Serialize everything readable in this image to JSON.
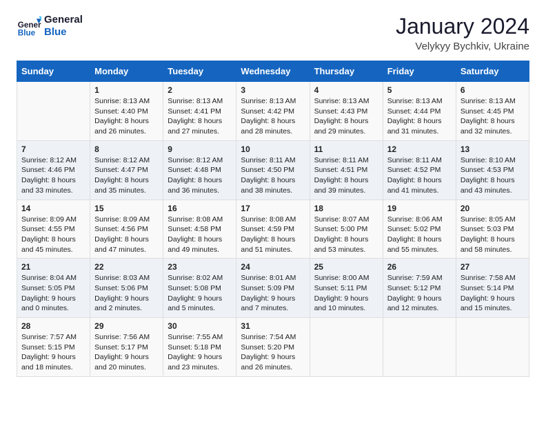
{
  "header": {
    "logo_line1": "General",
    "logo_line2": "Blue",
    "title": "January 2024",
    "subtitle": "Velykyy Bychkiv, Ukraine"
  },
  "columns": [
    "Sunday",
    "Monday",
    "Tuesday",
    "Wednesday",
    "Thursday",
    "Friday",
    "Saturday"
  ],
  "weeks": [
    [
      {
        "day": "",
        "text": ""
      },
      {
        "day": "1",
        "text": "Sunrise: 8:13 AM\nSunset: 4:40 PM\nDaylight: 8 hours\nand 26 minutes."
      },
      {
        "day": "2",
        "text": "Sunrise: 8:13 AM\nSunset: 4:41 PM\nDaylight: 8 hours\nand 27 minutes."
      },
      {
        "day": "3",
        "text": "Sunrise: 8:13 AM\nSunset: 4:42 PM\nDaylight: 8 hours\nand 28 minutes."
      },
      {
        "day": "4",
        "text": "Sunrise: 8:13 AM\nSunset: 4:43 PM\nDaylight: 8 hours\nand 29 minutes."
      },
      {
        "day": "5",
        "text": "Sunrise: 8:13 AM\nSunset: 4:44 PM\nDaylight: 8 hours\nand 31 minutes."
      },
      {
        "day": "6",
        "text": "Sunrise: 8:13 AM\nSunset: 4:45 PM\nDaylight: 8 hours\nand 32 minutes."
      }
    ],
    [
      {
        "day": "7",
        "text": "Sunrise: 8:12 AM\nSunset: 4:46 PM\nDaylight: 8 hours\nand 33 minutes."
      },
      {
        "day": "8",
        "text": "Sunrise: 8:12 AM\nSunset: 4:47 PM\nDaylight: 8 hours\nand 35 minutes."
      },
      {
        "day": "9",
        "text": "Sunrise: 8:12 AM\nSunset: 4:48 PM\nDaylight: 8 hours\nand 36 minutes."
      },
      {
        "day": "10",
        "text": "Sunrise: 8:11 AM\nSunset: 4:50 PM\nDaylight: 8 hours\nand 38 minutes."
      },
      {
        "day": "11",
        "text": "Sunrise: 8:11 AM\nSunset: 4:51 PM\nDaylight: 8 hours\nand 39 minutes."
      },
      {
        "day": "12",
        "text": "Sunrise: 8:11 AM\nSunset: 4:52 PM\nDaylight: 8 hours\nand 41 minutes."
      },
      {
        "day": "13",
        "text": "Sunrise: 8:10 AM\nSunset: 4:53 PM\nDaylight: 8 hours\nand 43 minutes."
      }
    ],
    [
      {
        "day": "14",
        "text": "Sunrise: 8:09 AM\nSunset: 4:55 PM\nDaylight: 8 hours\nand 45 minutes."
      },
      {
        "day": "15",
        "text": "Sunrise: 8:09 AM\nSunset: 4:56 PM\nDaylight: 8 hours\nand 47 minutes."
      },
      {
        "day": "16",
        "text": "Sunrise: 8:08 AM\nSunset: 4:58 PM\nDaylight: 8 hours\nand 49 minutes."
      },
      {
        "day": "17",
        "text": "Sunrise: 8:08 AM\nSunset: 4:59 PM\nDaylight: 8 hours\nand 51 minutes."
      },
      {
        "day": "18",
        "text": "Sunrise: 8:07 AM\nSunset: 5:00 PM\nDaylight: 8 hours\nand 53 minutes."
      },
      {
        "day": "19",
        "text": "Sunrise: 8:06 AM\nSunset: 5:02 PM\nDaylight: 8 hours\nand 55 minutes."
      },
      {
        "day": "20",
        "text": "Sunrise: 8:05 AM\nSunset: 5:03 PM\nDaylight: 8 hours\nand 58 minutes."
      }
    ],
    [
      {
        "day": "21",
        "text": "Sunrise: 8:04 AM\nSunset: 5:05 PM\nDaylight: 9 hours\nand 0 minutes."
      },
      {
        "day": "22",
        "text": "Sunrise: 8:03 AM\nSunset: 5:06 PM\nDaylight: 9 hours\nand 2 minutes."
      },
      {
        "day": "23",
        "text": "Sunrise: 8:02 AM\nSunset: 5:08 PM\nDaylight: 9 hours\nand 5 minutes."
      },
      {
        "day": "24",
        "text": "Sunrise: 8:01 AM\nSunset: 5:09 PM\nDaylight: 9 hours\nand 7 minutes."
      },
      {
        "day": "25",
        "text": "Sunrise: 8:00 AM\nSunset: 5:11 PM\nDaylight: 9 hours\nand 10 minutes."
      },
      {
        "day": "26",
        "text": "Sunrise: 7:59 AM\nSunset: 5:12 PM\nDaylight: 9 hours\nand 12 minutes."
      },
      {
        "day": "27",
        "text": "Sunrise: 7:58 AM\nSunset: 5:14 PM\nDaylight: 9 hours\nand 15 minutes."
      }
    ],
    [
      {
        "day": "28",
        "text": "Sunrise: 7:57 AM\nSunset: 5:15 PM\nDaylight: 9 hours\nand 18 minutes."
      },
      {
        "day": "29",
        "text": "Sunrise: 7:56 AM\nSunset: 5:17 PM\nDaylight: 9 hours\nand 20 minutes."
      },
      {
        "day": "30",
        "text": "Sunrise: 7:55 AM\nSunset: 5:18 PM\nDaylight: 9 hours\nand 23 minutes."
      },
      {
        "day": "31",
        "text": "Sunrise: 7:54 AM\nSunset: 5:20 PM\nDaylight: 9 hours\nand 26 minutes."
      },
      {
        "day": "",
        "text": ""
      },
      {
        "day": "",
        "text": ""
      },
      {
        "day": "",
        "text": ""
      }
    ]
  ]
}
